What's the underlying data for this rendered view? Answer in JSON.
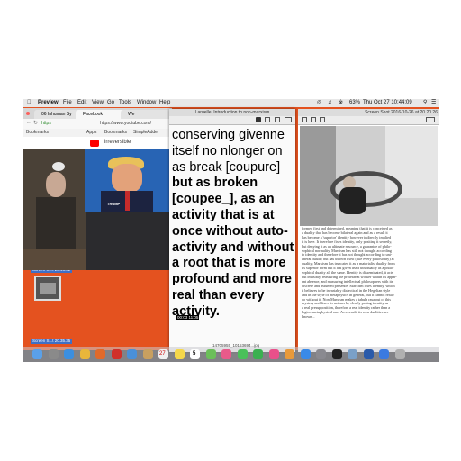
{
  "menubar": {
    "app_name": "Preview",
    "menus": [
      "File",
      "Edit",
      "View",
      "Go",
      "Tools",
      "Window",
      "Help"
    ],
    "clock": "Thu Oct 27 10:44:09",
    "battery": "63%"
  },
  "chrome": {
    "tabs": [
      {
        "label": "06 Inhuman Sy",
        "color": "#e3e3e3"
      },
      {
        "label": "Facebook",
        "color": "#f2f2f2"
      },
      {
        "label": "We",
        "color": "#e3e3e3"
      }
    ],
    "url": "https://www.youtube.com/",
    "url_partial_left": "https",
    "bookmarks": [
      "Bookmarks",
      "Apps",
      "Bookmarks",
      "SimpleAdder"
    ],
    "youtube_search": "irreversible",
    "video_caption": "TRUMP"
  },
  "preview_window": {
    "title": "Laruelle. Introduction to non-marxism",
    "lines": [
      "conserving givenne",
      "itself no nlonger on",
      "as break [coupure]",
      "but as broken",
      "[coupee_], as an",
      "activity that is at",
      "once without auto-",
      "activity and without",
      "a root that is more",
      "profound and more",
      "real than every",
      "activity."
    ],
    "overlay_time": "00:03 11:05"
  },
  "screenshot_window": {
    "title": "Screen Shot 2016-10-26 at 20.20.26",
    "text_lines": [
      "formed first and determined, meaning that it is conceived as",
      "a duality that has become bilateral again and as a result it",
      "has become a 'superior' identity however indirectly implied",
      "it is here. It therefore fixes identity, only positing it secretly,",
      "but denying it as an ultimate resource, a guarantee of philo-",
      "sophical normality. Marxism has still not thought according",
      "to identity and therefore it has not thought according to uni-",
      "lateral duality but has thrown itself (like every philosophy) at",
      "duality; Marxism has truncated it as a materialist duality from",
      "its superior form but it has given itself this duality as a philo-",
      "sophical duality all the same. Identity is disseminated, it acts",
      "but invisibly, reassuring the proletariat worker within its appar-",
      "ent absence, and reassuring intellectual philosophers with its",
      "discrete and assumed presence. Marxism fixes identity, which",
      "it believes to be invariably dialectical in the Hegelian style",
      "and in the style of metaphysics in general, but it cannot really",
      "do without it. Non-Marxism makes a tabula rasa out of this",
      "mystery and fixes its axioms by clearly posing identity as",
      "a real presupposition, therefore a real identity rather than a",
      "logico-metaphysical one. As a result, its own dualities are",
      "known..."
    ]
  },
  "desktop": {
    "file1": "Screen S...t 20.46.02",
    "file2": "Screen S...t 20.35.35",
    "download_label": "14705955_10153694...jpg"
  },
  "dock": {
    "icons": [
      "finder-icon",
      "launchpad-icon",
      "safari-icon",
      "chrome-icon",
      "firefox-icon",
      "opera-icon",
      "mail-icon",
      "contacts-icon",
      "calendar-icon",
      "notes-icon",
      "reminders-icon",
      "maps-icon",
      "photos-icon",
      "messages-icon",
      "facetime-icon",
      "itunes-icon",
      "ibooks-icon",
      "appstore-icon",
      "prefs-icon",
      "terminal-icon",
      "preview-icon",
      "word-icon",
      "downloads-icon",
      "trash-icon"
    ],
    "badge_number": "5",
    "calendar_day": "27"
  },
  "colors": {
    "desktop": "#e4521f",
    "youtube_red": "#ff0000",
    "menubar": "#e8e8e8"
  }
}
